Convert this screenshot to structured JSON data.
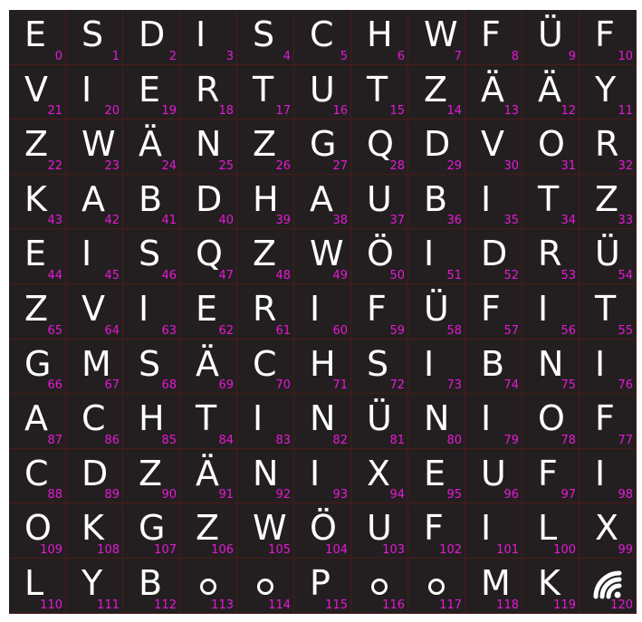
{
  "grid": {
    "rows": [
      [
        [
          "E",
          "0"
        ],
        [
          "S",
          "1"
        ],
        [
          "D",
          "2"
        ],
        [
          "I",
          "3"
        ],
        [
          "S",
          "4"
        ],
        [
          "C",
          "5"
        ],
        [
          "H",
          "6"
        ],
        [
          "W",
          "7"
        ],
        [
          "F",
          "8"
        ],
        [
          "Ü",
          "9"
        ],
        [
          "F",
          "10"
        ]
      ],
      [
        [
          "V",
          "21"
        ],
        [
          "I",
          "20"
        ],
        [
          "E",
          "19"
        ],
        [
          "R",
          "18"
        ],
        [
          "T",
          "17"
        ],
        [
          "U",
          "16"
        ],
        [
          "T",
          "15"
        ],
        [
          "Z",
          "14"
        ],
        [
          "Ä",
          "13"
        ],
        [
          "Ä",
          "12"
        ],
        [
          "Y",
          "11"
        ]
      ],
      [
        [
          "Z",
          "22"
        ],
        [
          "W",
          "23"
        ],
        [
          "Ä",
          "24"
        ],
        [
          "N",
          "25"
        ],
        [
          "Z",
          "26"
        ],
        [
          "G",
          "27"
        ],
        [
          "Q",
          "28"
        ],
        [
          "D",
          "29"
        ],
        [
          "V",
          "30"
        ],
        [
          "O",
          "31"
        ],
        [
          "R",
          "32"
        ]
      ],
      [
        [
          "K",
          "43"
        ],
        [
          "A",
          "42"
        ],
        [
          "B",
          "41"
        ],
        [
          "D",
          "40"
        ],
        [
          "H",
          "39"
        ],
        [
          "A",
          "38"
        ],
        [
          "U",
          "37"
        ],
        [
          "B",
          "36"
        ],
        [
          "I",
          "35"
        ],
        [
          "T",
          "34"
        ],
        [
          "Z",
          "33"
        ]
      ],
      [
        [
          "E",
          "44"
        ],
        [
          "I",
          "45"
        ],
        [
          "S",
          "46"
        ],
        [
          "Q",
          "47"
        ],
        [
          "Z",
          "48"
        ],
        [
          "W",
          "49"
        ],
        [
          "Ö",
          "50"
        ],
        [
          "I",
          "51"
        ],
        [
          "D",
          "52"
        ],
        [
          "R",
          "53"
        ],
        [
          "Ü",
          "54"
        ]
      ],
      [
        [
          "Z",
          "65"
        ],
        [
          "V",
          "64"
        ],
        [
          "I",
          "63"
        ],
        [
          "E",
          "62"
        ],
        [
          "R",
          "61"
        ],
        [
          "I",
          "60"
        ],
        [
          "F",
          "59"
        ],
        [
          "Ü",
          "58"
        ],
        [
          "F",
          "57"
        ],
        [
          "I",
          "56"
        ],
        [
          "T",
          "55"
        ]
      ],
      [
        [
          "G",
          "66"
        ],
        [
          "M",
          "67"
        ],
        [
          "S",
          "68"
        ],
        [
          "Ä",
          "69"
        ],
        [
          "C",
          "70"
        ],
        [
          "H",
          "71"
        ],
        [
          "S",
          "72"
        ],
        [
          "I",
          "73"
        ],
        [
          "B",
          "74"
        ],
        [
          "N",
          "75"
        ],
        [
          "I",
          "76"
        ]
      ],
      [
        [
          "A",
          "87"
        ],
        [
          "C",
          "86"
        ],
        [
          "H",
          "85"
        ],
        [
          "T",
          "84"
        ],
        [
          "I",
          "83"
        ],
        [
          "N",
          "82"
        ],
        [
          "Ü",
          "81"
        ],
        [
          "N",
          "80"
        ],
        [
          "I",
          "79"
        ],
        [
          "O",
          "78"
        ],
        [
          "F",
          "77"
        ]
      ],
      [
        [
          "C",
          "88"
        ],
        [
          "D",
          "89"
        ],
        [
          "Z",
          "90"
        ],
        [
          "Ä",
          "91"
        ],
        [
          "N",
          "92"
        ],
        [
          "I",
          "93"
        ],
        [
          "X",
          "94"
        ],
        [
          "E",
          "95"
        ],
        [
          "U",
          "96"
        ],
        [
          "F",
          "97"
        ],
        [
          "I",
          "98"
        ]
      ],
      [
        [
          "O",
          "109"
        ],
        [
          "K",
          "108"
        ],
        [
          "G",
          "107"
        ],
        [
          "Z",
          "106"
        ],
        [
          "W",
          "105"
        ],
        [
          "Ö",
          "104"
        ],
        [
          "U",
          "103"
        ],
        [
          "F",
          "102"
        ],
        [
          "I",
          "101"
        ],
        [
          "L",
          "100"
        ],
        [
          "X",
          "99"
        ]
      ],
      [
        [
          "L",
          "110"
        ],
        [
          "Y",
          "111"
        ],
        [
          "B",
          "112"
        ],
        [
          "circle-icon",
          "113"
        ],
        [
          "circle-icon",
          "114"
        ],
        [
          "P",
          "115"
        ],
        [
          "circle-icon",
          "116"
        ],
        [
          "circle-icon",
          "117"
        ],
        [
          "M",
          "118"
        ],
        [
          "K",
          "119"
        ],
        [
          "wifi-icon",
          "120"
        ]
      ]
    ]
  },
  "colors": {
    "background": "#231f20",
    "letter": "#ffffff",
    "index": "#e619d5",
    "divider": "#4a1a1a"
  }
}
